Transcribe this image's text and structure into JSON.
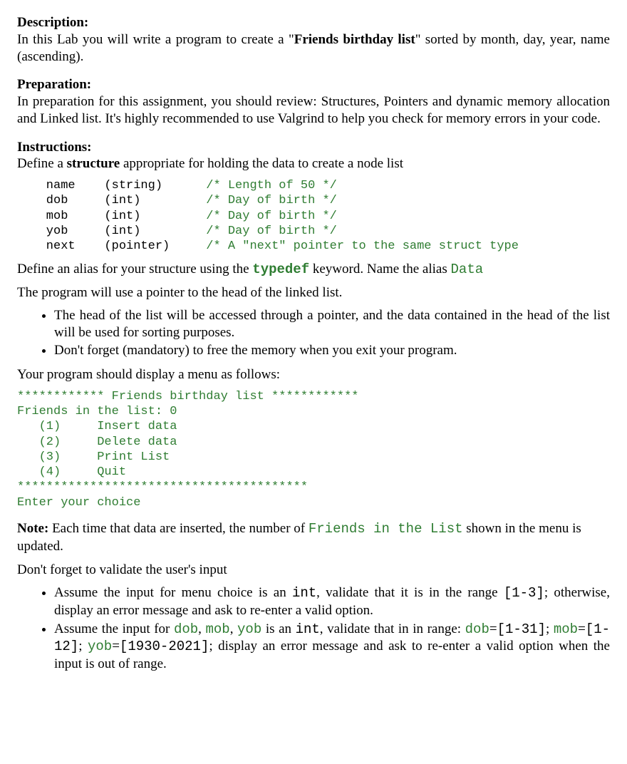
{
  "sec1": {
    "head": "Description:",
    "body_pre": "In this Lab you will write a program to create a \"",
    "body_bold": "Friends birthday list",
    "body_post": "\" sorted by month, day, year, name (ascending)."
  },
  "sec2": {
    "head": "Preparation:",
    "body": "In preparation for this assignment, you should review: Structures, Pointers and dynamic memory allocation and Linked list.  It's highly recommended to use Valgrind to help you check for memory errors in your code."
  },
  "sec3": {
    "head": "Instructions:",
    "intro_pre": "Define a ",
    "intro_bold": "structure",
    "intro_post": " appropriate for holding the data to create a node list"
  },
  "struct_rows": [
    {
      "field": "name",
      "type": "(string)",
      "comment": "/* Length of 50 */"
    },
    {
      "field": "dob",
      "type": "(int)",
      "comment": "/* Day of birth */"
    },
    {
      "field": "mob",
      "type": "(int)",
      "comment": "/* Day of birth */"
    },
    {
      "field": "yob",
      "type": "(int)",
      "comment": "/* Day of birth */"
    },
    {
      "field": "next",
      "type": "(pointer)",
      "comment": "/* A \"next\" pointer to the same struct type"
    }
  ],
  "alias": {
    "pre": "Define an alias for your structure using the ",
    "code1": "typedef",
    "mid": " keyword. Name the alias ",
    "code2": "Data"
  },
  "headptr": {
    "intro": "The program will use a pointer to the head of the linked list.",
    "b1": "The head of the list will be accessed through a pointer, and the data contained in the head of the list will be used for sorting purposes.",
    "b2": "Don't forget (mandatory) to free the memory when you exit your program."
  },
  "menu_intro": "Your program should display a menu as follows:",
  "menu_text": "************ Friends birthday list ************\nFriends in the list: 0\n   (1)     Insert data\n   (2)     Delete data\n   (3)     Print List\n   (4)     Quit\n****************************************\nEnter your choice",
  "note": {
    "head": "Note:",
    "t1": " Each time that data are inserted, the number of ",
    "code1": "Friends in the List",
    "t2": " shown in the menu is updated."
  },
  "validate": {
    "intro": "Don't forget to validate the user's input",
    "b1": {
      "t1": "Assume the input for menu choice is an ",
      "c1": "int",
      "t2": ", validate that it is in the range ",
      "c2": "[1-3]",
      "t3": "; otherwise, display an error message and ask to re-enter a valid option."
    },
    "b2": {
      "t1": "Assume the input for ",
      "c1": "dob",
      "t2": ", ",
      "c2": "mob",
      "t3": ", ",
      "c3": "yob",
      "t4": " is an ",
      "c4": "int",
      "t5": ", validate that in in range: ",
      "c5": "dob",
      "t6": "=",
      "c6": "[1-31]",
      "t7": "; ",
      "c7": "mob",
      "t8": "=",
      "c8": "[1-12]",
      "t9": ";  ",
      "c9": "yob",
      "t10": "=",
      "c10": "[1930-2021]",
      "t11": "; display an error message and ask to re-enter a valid option when the input is out of range."
    }
  }
}
